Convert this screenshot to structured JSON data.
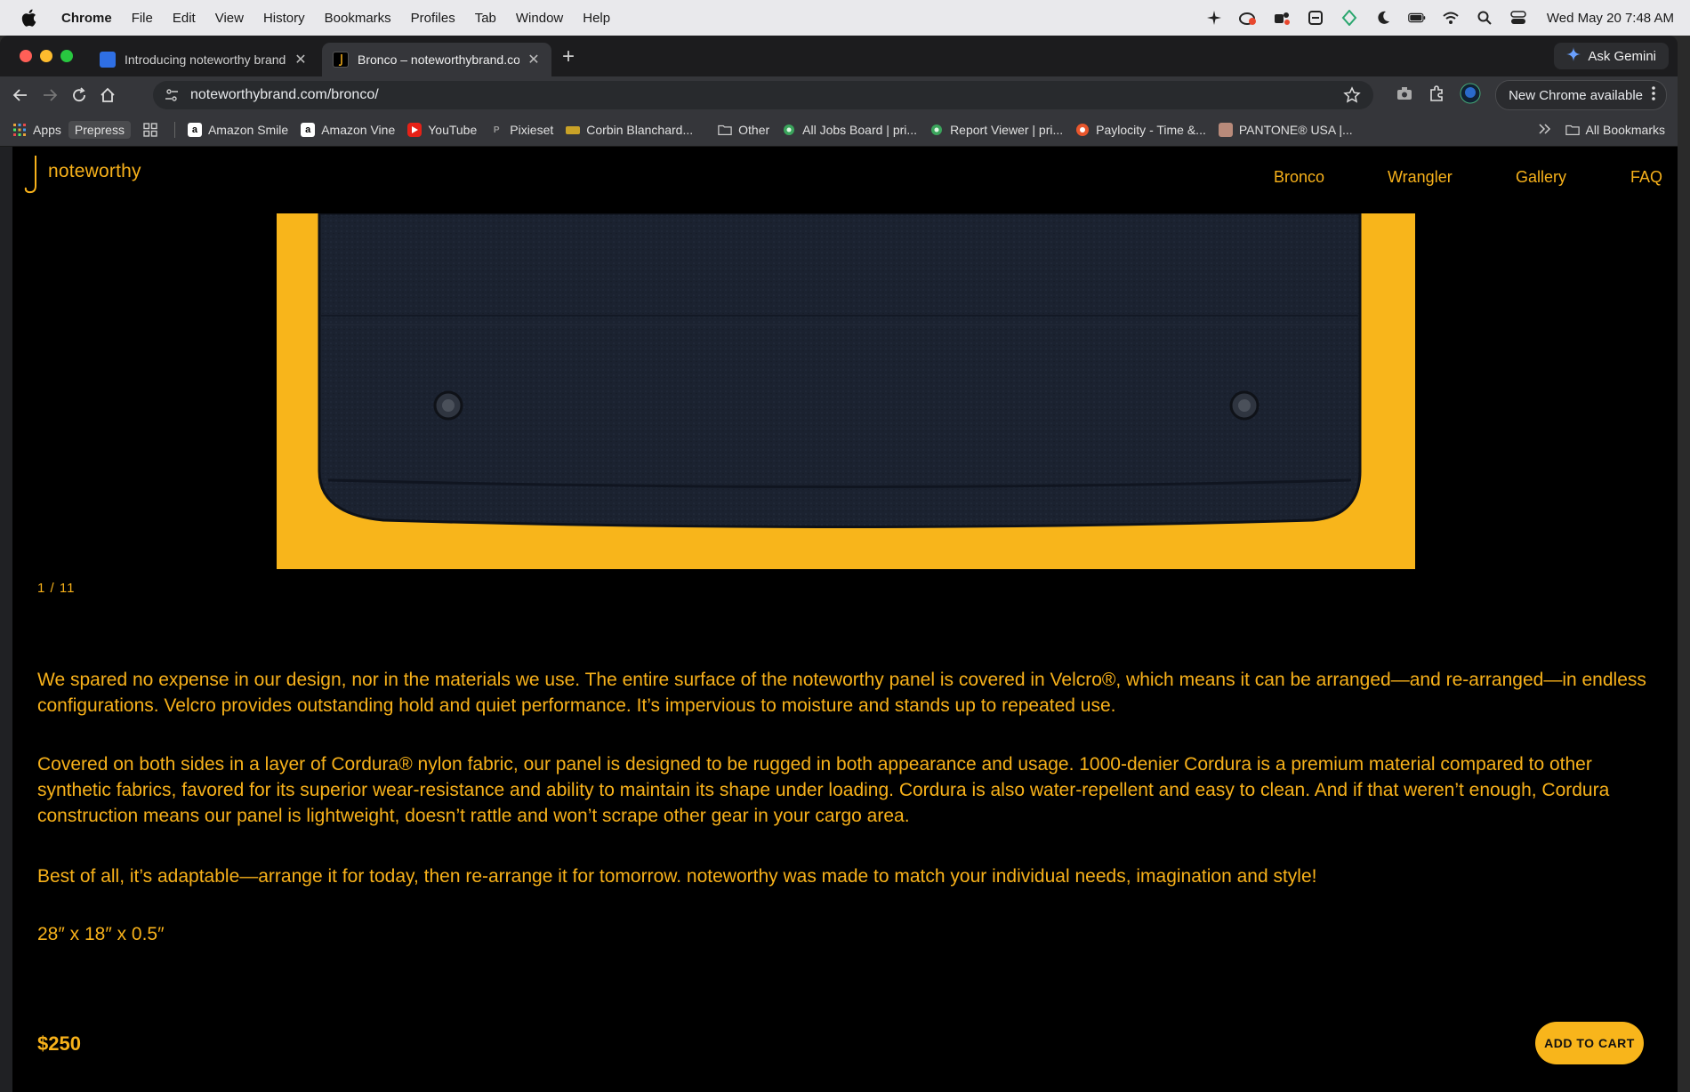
{
  "menubar": {
    "app": "Chrome",
    "items": [
      "File",
      "Edit",
      "View",
      "History",
      "Bookmarks",
      "Profiles",
      "Tab",
      "Window",
      "Help"
    ],
    "clock": "Wed May 20  7:48 AM"
  },
  "tabs": [
    {
      "title": "Introducing noteworthy brand",
      "active": false
    },
    {
      "title": "Bronco – noteworthybrand.co",
      "active": true
    }
  ],
  "gemini": {
    "label": "Ask Gemini"
  },
  "omnibox": {
    "url": "noteworthybrand.com/bronco/"
  },
  "toolbar": {
    "update_label": "New Chrome available"
  },
  "bookmarks": {
    "apps": "Apps",
    "prepress": "Prepress",
    "items": [
      "Amazon Smile",
      "Amazon Vine",
      "YouTube",
      "Pixieset",
      "Corbin Blanchard...",
      "Other",
      "All Jobs Board | pri...",
      "Report Viewer | pri...",
      "Paylocity - Time &...",
      "PANTONE® USA |..."
    ],
    "all": "All Bookmarks"
  },
  "site": {
    "logo_text": "noteworthy",
    "nav": [
      "Bronco",
      "Wrangler",
      "Gallery",
      "FAQ"
    ],
    "counter": "1 / 11",
    "paragraphs": [
      "We spared no expense in our design, nor in the materials we use. The entire surface of the noteworthy panel is covered in Velcro®, which means it can be arranged—and re-arranged—in endless configurations. Velcro provides outstanding hold and quiet performance. It’s impervious to moisture and stands up to repeated use.",
      "Covered on both sides in a layer of Cordura® nylon fabric, our panel is designed to be rugged in both appearance and usage. 1000-denier Cordura is a premium material compared to other synthetic fabrics, favored for its superior wear-resistance and ability to maintain its shape under loading. Cordura is also water-repellent and easy to clean. And if that weren’t enough, Cordura construction means our panel is lightweight, doesn’t rattle and won’t scrape other gear in your cargo area.",
      "Best of all, it’s adaptable—arrange it for today, then re-arrange it for tomorrow. noteworthy was made to match your individual needs, imagination and style!",
      "28″ x 18″ x 0.5″"
    ],
    "price": "$250",
    "cart_label": "ADD TO CART"
  },
  "colors": {
    "brand": "#f7b11a",
    "page_bg": "#000000",
    "panel": "#1d2433"
  }
}
